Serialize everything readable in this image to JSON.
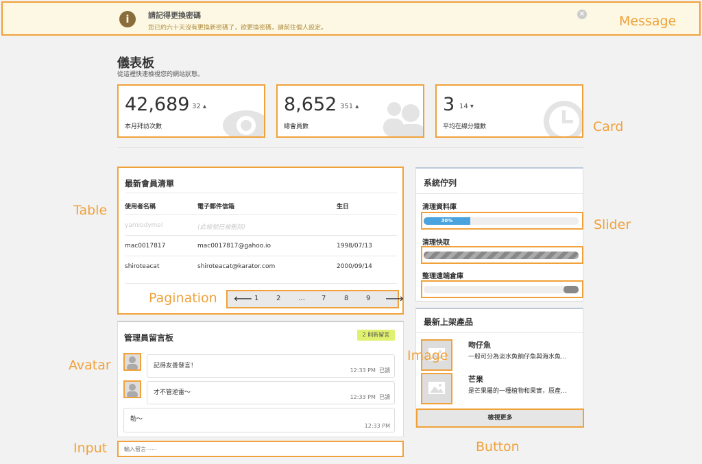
{
  "message": {
    "title": "請記得更換密碼",
    "body": "您已約六十天沒有更換新密碼了，欲更換密碼，請前往個人設定。"
  },
  "header": {
    "title": "儀表板",
    "subtitle": "從這裡快速檢視您的網站狀態。"
  },
  "cards": [
    {
      "value": "42,689",
      "delta": "32",
      "trend": "up",
      "label": "本月拜訪次數",
      "icon": "eye-icon"
    },
    {
      "value": "8,652",
      "delta": "351",
      "trend": "up",
      "label": "總會員數",
      "icon": "users-icon"
    },
    {
      "value": "3",
      "delta": "14",
      "trend": "down",
      "label": "平均在線分鐘數",
      "icon": "clock-icon"
    }
  ],
  "members": {
    "title": "最新會員清單",
    "columns": [
      "使用者名稱",
      "電子郵件信箱",
      "生日"
    ],
    "rows": [
      {
        "username": "yamiodymel",
        "email": "(此帳號已被刪除)",
        "birthday": ""
      },
      {
        "username": "mac0017817",
        "email": "mac0017817@gahoo.io",
        "birthday": "1998/07/13"
      },
      {
        "username": "shiroteacat",
        "email": "shiroteacat@karator.com",
        "birthday": "2000/09/14"
      }
    ],
    "pagination": [
      "1",
      "2",
      "…",
      "7",
      "8",
      "9"
    ]
  },
  "board": {
    "title": "管理員留言板",
    "badge": "2 則新留言",
    "messages": [
      {
        "text": "記得友善發言！",
        "time": "12:33 PM",
        "status": "已讀"
      },
      {
        "text": "才不管逆雷～",
        "time": "12:33 PM",
        "status": "已讀"
      },
      {
        "text": "勒～",
        "time": "12:33 PM"
      }
    ],
    "input_placeholder": "輸入留言⋯⋯"
  },
  "queue": {
    "title": "系統佇列",
    "items": [
      {
        "label": "清理資料庫",
        "progress": 0.3,
        "progress_text": "30%"
      },
      {
        "label": "清理快取"
      },
      {
        "label": "整理遠端倉庫"
      }
    ]
  },
  "products": {
    "title": "最新上架產品",
    "items": [
      {
        "name": "吻仔魚",
        "desc": "一般可分為淡水魚餉仔魚與海水魚…"
      },
      {
        "name": "芒果",
        "desc": "是芒果屬的一種植物和果實，原產…"
      }
    ],
    "more_label": "檢視更多"
  },
  "annotations": {
    "message": "Message",
    "card": "Card",
    "table": "Table",
    "slider": "Slider",
    "pagination": "Pagination",
    "avatar": "Avatar",
    "image": "Image",
    "input": "Input",
    "button": "Button"
  },
  "colors": {
    "annotation": "#f0a13a",
    "message_bg": "#fcf8e3",
    "progress": "#4aa3df",
    "badge": "#e0f06f"
  }
}
